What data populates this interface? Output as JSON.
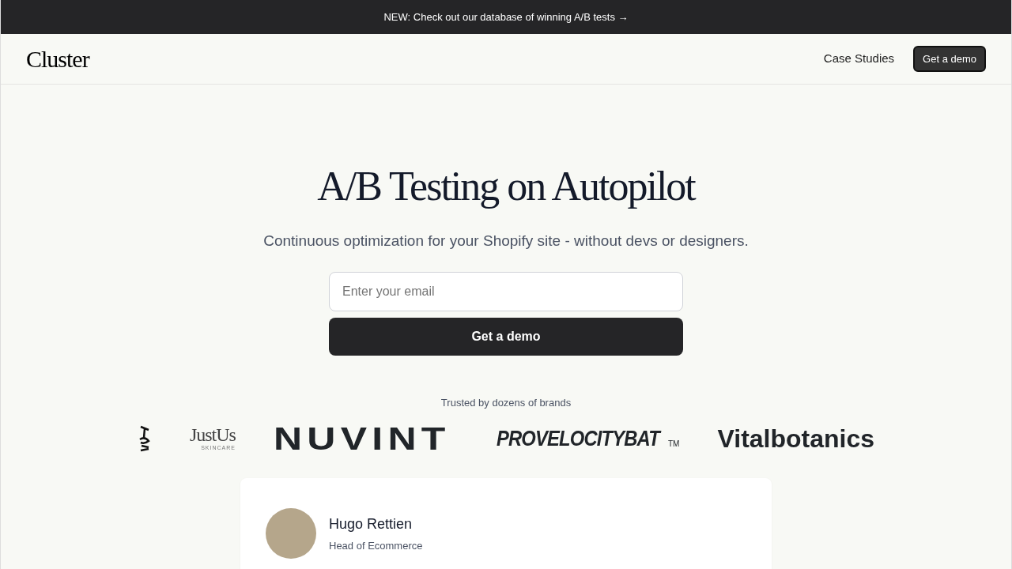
{
  "announcement": {
    "text": "NEW: Check out our database of winning A/B tests →"
  },
  "navbar": {
    "logo": "Cluster",
    "links": [
      "Case Studies"
    ],
    "cta": "Get a demo"
  },
  "hero": {
    "title": "A/B Testing on Autopilot",
    "subtitle": "Continuous optimization for your Shopify site - without devs or designers.",
    "email": {
      "placeholder": "Enter your email"
    },
    "button": "Get a demo"
  },
  "brands": {
    "caption": "Trusted by dozens of brands",
    "logos": [
      {
        "kind": "mark"
      },
      {
        "kind": "script",
        "name": "JustUs",
        "sub": "SKINCARE"
      },
      {
        "kind": "wide",
        "name": "NUVINT"
      },
      {
        "kind": "italic",
        "name": "PROVELOCITYBAT",
        "sub": "TM"
      },
      {
        "kind": "bold",
        "name": "Vitalbotanics"
      }
    ]
  },
  "testimonial": {
    "name": "Hugo Rettien",
    "role": "Head of Ecommerce"
  }
}
